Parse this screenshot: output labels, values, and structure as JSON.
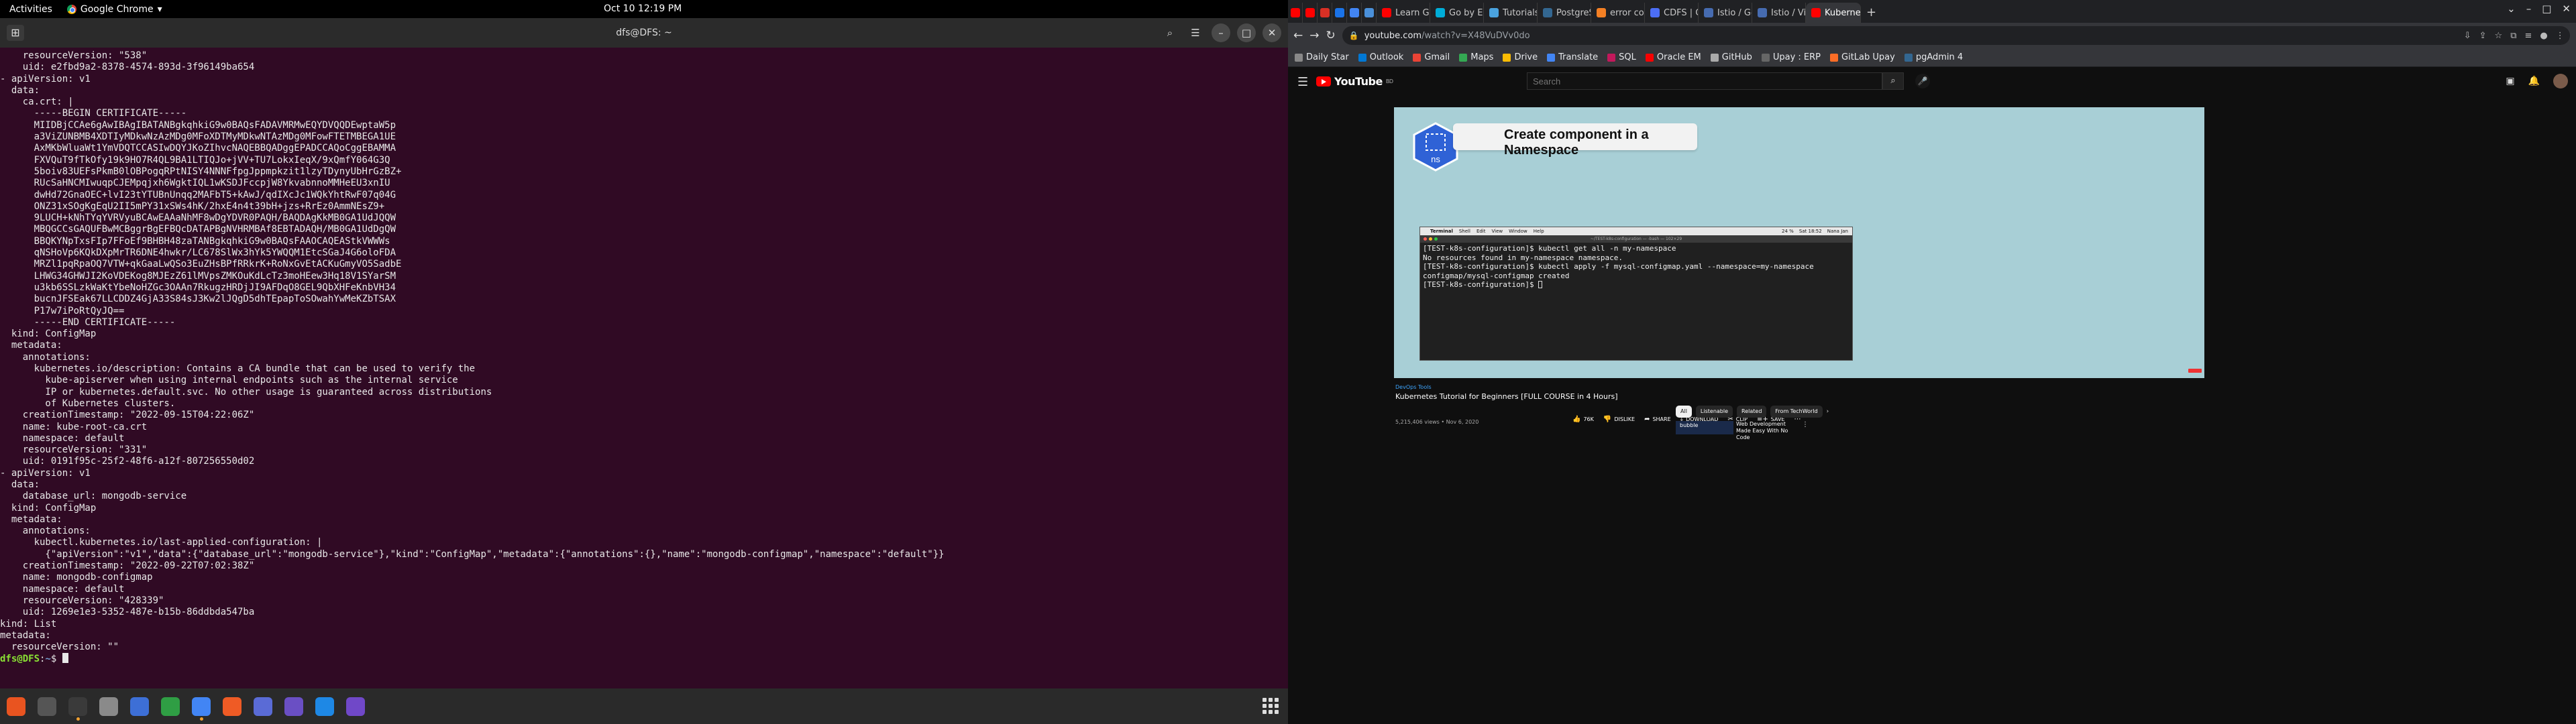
{
  "topbar": {
    "activities": "Activities",
    "app_name": "Google Chrome",
    "clock": "Oct 10  12:19 PM"
  },
  "terminal": {
    "title": "dfs@DFS: ~",
    "lines": [
      "    resourceVersion: \"538\"",
      "    uid: e2fbd9a2-8378-4574-893d-3f96149ba654",
      "- apiVersion: v1",
      "  data:",
      "    ca.crt: |",
      "      -----BEGIN CERTIFICATE-----",
      "      MIIDBjCCAe6gAwIBAgIBATANBgkqhkiG9w0BAQsFADAVMRMwEQYDVQQDEwptaW5p",
      "      a3ViZUNBMB4XDTIyMDkwNzAzMDg0MFoXDTMyMDkwNTAzMDg0MFowFTETMBEGA1UE",
      "      AxMKbWluaWt1YmVDQTCCASIwDQYJKoZIhvcNAQEBBQADggEPADCCAQoCggEBAMMA",
      "      FXVQuT9fTkOfy19k9HO7R4QL9BA1LTIQJo+jVV+TU7LokxIeqX/9xQmfY064G3Q",
      "      5boiv83UEFsPkmB0lOBPogqRPtNISY4NNNFfpgJppmpkzit1lzyTDynyUbHrGzBZ+",
      "      RUcSaHNCMIwuqpCJEMpqjxh6WgktIQL1wKSDJFccpjW8YkvabnnoMMHeEU3xnIU",
      "      dwHd72GnaOEC+lvI23tYTUBnUnqq2MAFbT5+kAwJ/qdIXcJc1WQkYhtRwF07q04G",
      "      ONZ31xSOgKgEqU2II5mPY31xSWs4hK/2hxE4n4t39bH+jzs+RrEz0AmmNEsZ9+",
      "      9LUCH+kNhTYqYVRVyuBCAwEAAaNhMF8wDgYDVR0PAQH/BAQDAgKkMB0GA1UdJQQW",
      "      MBQGCCsGAQUFBwMCBggrBgEFBQcDATAPBgNVHRMBAf8EBTADAQH/MB0GA1UdDgQW",
      "      BBQKYNpTxsFIp7FFoEf9BHBH48zaTANBgkqhkiG9w0BAQsFAAOCAQEAStkVWWWs",
      "      qNSHoVp6KQkDXpMrTR6DNE4hwkr/LC678SlWx3hYk5YWQQM1EtcSGaJ4G6oloFDA",
      "      MRZl1pqRpaOQ7VTW+qkGaaLwQSo3EuZHsBPfRRkrK+RoNxGvEtACKuGmyVO5SadbE",
      "      LHWG34GHWJI2KoVDEKog8MJEzZ61lMVpsZMKOuKdLcTz3moHEew3Hq18V1SYarSM",
      "      u3kb6SSLzkWaKtYbeNoHZGc3OAAn7RkugzHRDjJI9AFDqO8GEL9QbXHFeKnbVH34",
      "      bucnJFSEak67LLCDDZ4GjA33S84sJ3Kw2lJQgD5dhTEpapToSOwahYwMeKZbTSAX",
      "      P17w7iPoRtQyJQ==",
      "      -----END CERTIFICATE-----",
      "  kind: ConfigMap",
      "  metadata:",
      "    annotations:",
      "      kubernetes.io/description: Contains a CA bundle that can be used to verify the",
      "        kube-apiserver when using internal endpoints such as the internal service",
      "        IP or kubernetes.default.svc. No other usage is guaranteed across distributions",
      "        of Kubernetes clusters.",
      "    creationTimestamp: \"2022-09-15T04:22:06Z\"",
      "    name: kube-root-ca.crt",
      "    namespace: default",
      "    resourceVersion: \"331\"",
      "    uid: 0191f95c-25f2-48f6-a12f-807256550d02",
      "- apiVersion: v1",
      "  data:",
      "    database_url: mongodb-service",
      "  kind: ConfigMap",
      "  metadata:",
      "    annotations:",
      "      kubectl.kubernetes.io/last-applied-configuration: |",
      "        {\"apiVersion\":\"v1\",\"data\":{\"database_url\":\"mongodb-service\"},\"kind\":\"ConfigMap\",\"metadata\":{\"annotations\":{},\"name\":\"mongodb-configmap\",\"namespace\":\"default\"}}",
      "    creationTimestamp: \"2022-09-22T07:02:38Z\"",
      "    name: mongodb-configmap",
      "    namespace: default",
      "    resourceVersion: \"428339\"",
      "    uid: 1269e1e3-5352-487e-b15b-86ddbda547ba",
      "kind: List",
      "metadata:",
      "  resourceVersion: \"\""
    ],
    "prompt_user": "dfs@DFS",
    "prompt_sep": ":",
    "prompt_path": "~",
    "prompt_end": "$ "
  },
  "dock": {
    "apps": [
      {
        "name": "ubuntu-software-icon",
        "color": "#e95420"
      },
      {
        "name": "disk-utility-icon",
        "color": "#555555"
      },
      {
        "name": "terminal-icon",
        "color": "#3a3a3a",
        "active": true
      },
      {
        "name": "files-icon",
        "color": "#8a8a8a"
      },
      {
        "name": "text-editor-icon",
        "color": "#3d6fd6"
      },
      {
        "name": "spreadsheet-icon",
        "color": "#2f9e44"
      },
      {
        "name": "chrome-icon",
        "color": "#4285f4",
        "active": true
      },
      {
        "name": "postman-icon",
        "color": "#ef5b25"
      },
      {
        "name": "draw-icon",
        "color": "#5a6bd6"
      },
      {
        "name": "screenshot-icon",
        "color": "#6a4fc4"
      },
      {
        "name": "vscode-icon",
        "color": "#1e88e5"
      },
      {
        "name": "kubernetes-app-icon",
        "color": "#7048c8"
      }
    ]
  },
  "browser": {
    "tabs_small_colors": [
      "#ff0000",
      "#ff0000",
      "#d93025",
      "#1a73e8",
      "#4285f4",
      "#4a90d9"
    ],
    "tabs": [
      {
        "label": "Learn Go Pro",
        "color": "#ff0000"
      },
      {
        "label": "Go by Exampl",
        "color": "#00add8"
      },
      {
        "label": "Tutorials - Th",
        "color": "#4aa3df"
      },
      {
        "label": "PostgreSQL T",
        "color": "#336791"
      },
      {
        "label": "error code ac",
        "color": "#f48024"
      },
      {
        "label": "CDFS | CDFS",
        "color": "#4c6ef5"
      },
      {
        "label": "Istio / Gettin",
        "color": "#466bb0"
      },
      {
        "label": "Istio / Visuali",
        "color": "#466bb0"
      },
      {
        "label": "Kubernete",
        "color": "#ff0000",
        "active": true
      }
    ],
    "url_host": "youtube.com",
    "url_path": "/watch?v=X48VuDVv0do",
    "bookmarks": [
      {
        "label": "Daily Star",
        "color": "#888888"
      },
      {
        "label": "Outlook",
        "color": "#0078d4"
      },
      {
        "label": "Gmail",
        "color": "#ea4335"
      },
      {
        "label": "Maps",
        "color": "#34a853"
      },
      {
        "label": "Drive",
        "color": "#fbbc04"
      },
      {
        "label": "Translate",
        "color": "#4285f4"
      },
      {
        "label": "SQL",
        "color": "#c2185b"
      },
      {
        "label": "Oracle EM",
        "color": "#f80000"
      },
      {
        "label": "GitHub",
        "color": "#aaaaaa"
      },
      {
        "label": "Upay : ERP",
        "color": "#666666"
      },
      {
        "label": "GitLab Upay",
        "color": "#fc6d26"
      },
      {
        "label": "pgAdmin 4",
        "color": "#336791"
      }
    ]
  },
  "youtube": {
    "logo_text": "YouTube",
    "logo_sup": "BD",
    "search_placeholder": "Search",
    "video": {
      "card_title": "Create component in a Namespace",
      "badge_label": "ns",
      "mac_menu": [
        "Terminal",
        "Shell",
        "Edit",
        "View",
        "Window",
        "Help"
      ],
      "mac_status": [
        "24 %",
        "Sat 18:52",
        "Nana Jan"
      ],
      "mac_title": "~/TEST-k8s-configuration — -bash — 102×29",
      "mac_lines": [
        "[TEST-k8s-configuration]$ kubectl get all -n my-namespace",
        "No resources found in my-namespace namespace.",
        "[TEST-k8s-configuration]$ kubectl apply -f mysql-configmap.yaml --namespace=my-namespace",
        "configmap/mysql-configmap created",
        "[TEST-k8s-configuration]$ "
      ]
    },
    "channel_tag": "DevOps Tools",
    "title": "Kubernetes Tutorial for Beginners [FULL COURSE in 4 Hours]",
    "views": "5,215,406 views • Nov 6, 2020",
    "actions": {
      "like": "76K",
      "dislike": "DISLIKE",
      "share": "SHARE",
      "download": "DOWNLOAD",
      "clip": "CLIP",
      "save": "SAVE"
    },
    "chips": [
      "All",
      "Listenable",
      "Related",
      "From TechWorld"
    ],
    "rec": {
      "thumb_text": "bubble",
      "title": "Web Development Made Easy With No Code"
    }
  }
}
